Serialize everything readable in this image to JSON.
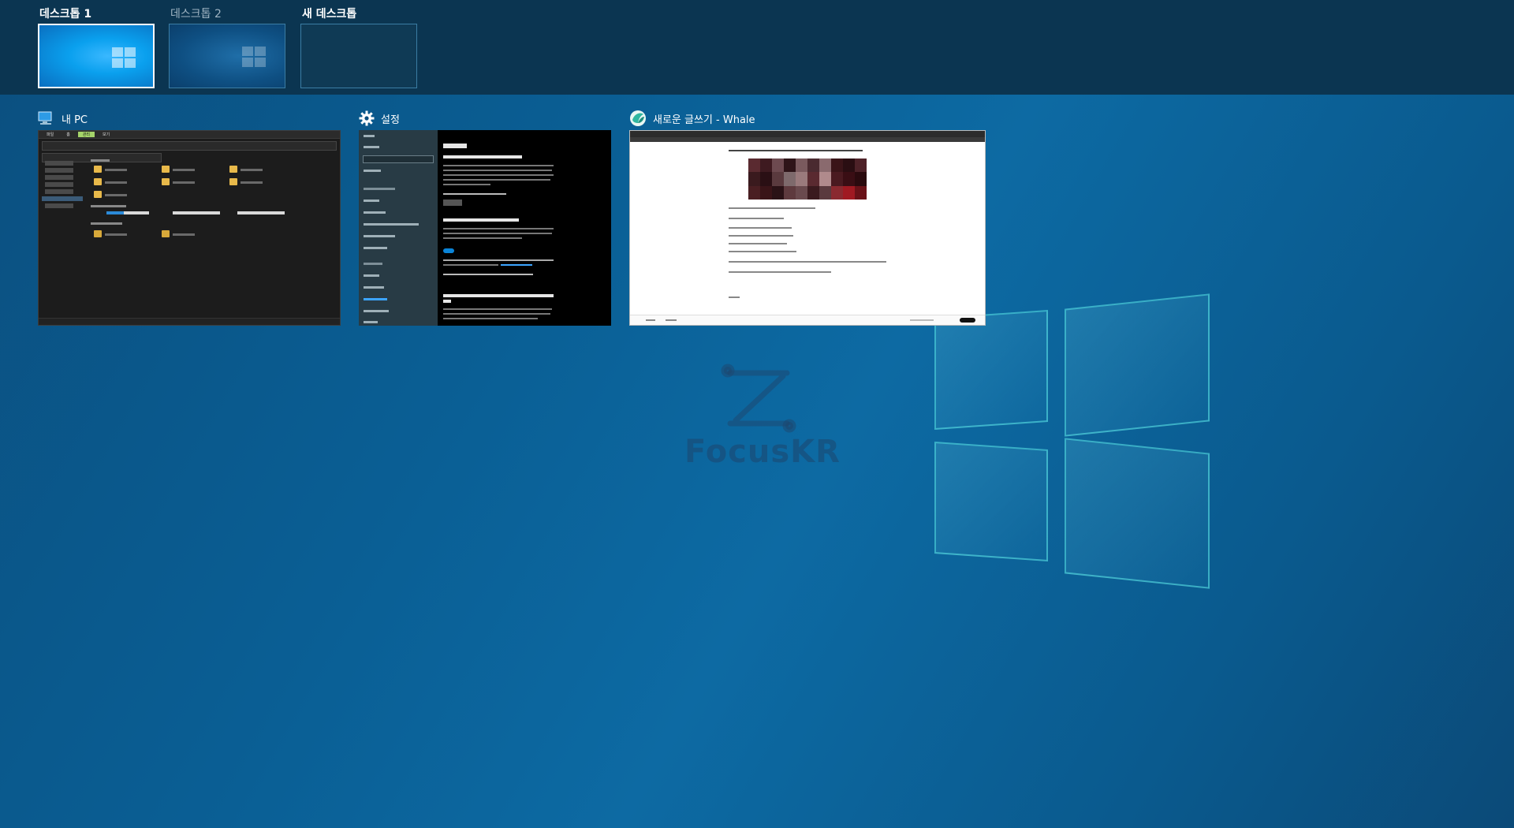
{
  "desktops": [
    {
      "label": "데스크톱 1",
      "active": true
    },
    {
      "label": "데스크톱 2",
      "active": false
    },
    {
      "label": "새 데스크톱",
      "active": false
    }
  ],
  "windows": [
    {
      "title": "내 PC",
      "icon": "computer-icon"
    },
    {
      "title": "설정",
      "icon": "gear-icon"
    },
    {
      "title": "새로운 글쓰기 - Whale",
      "icon": "whale-browser-icon"
    }
  ],
  "watermark": "FocusKR",
  "colors": {
    "accent": "#0a84d8",
    "strip": "#0b3551"
  }
}
